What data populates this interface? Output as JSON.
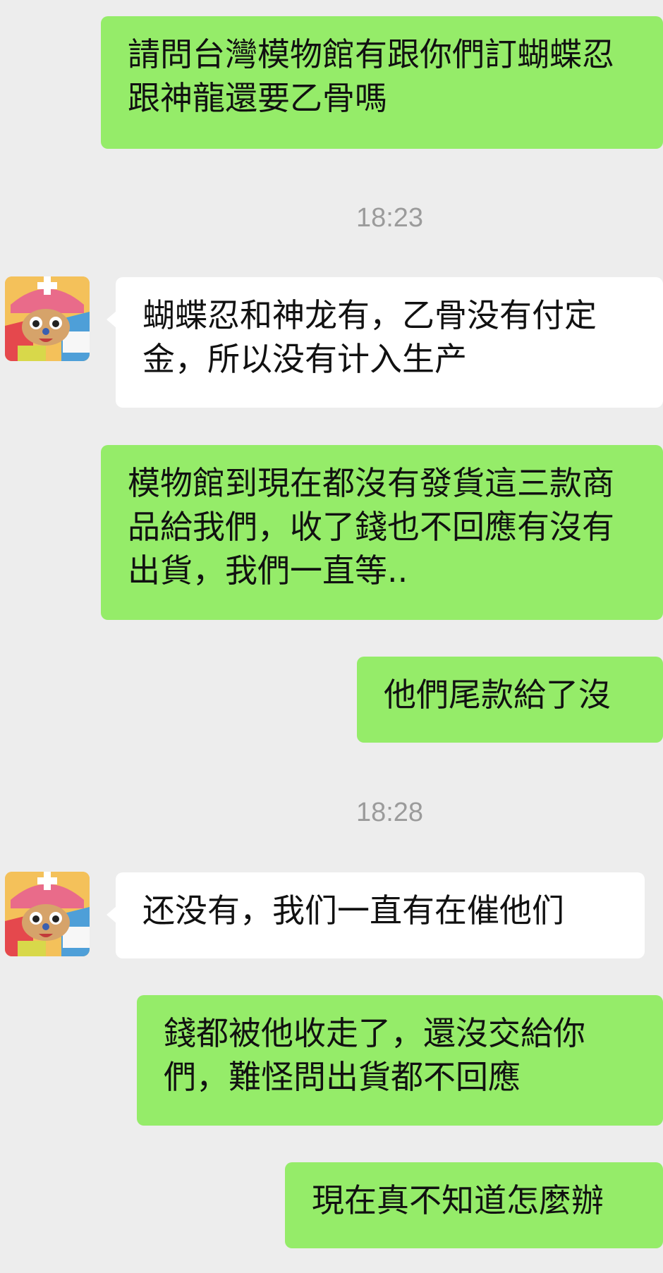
{
  "colors": {
    "background": "#ededed",
    "outgoing_bubble": "#95ec69",
    "incoming_bubble": "#ffffff",
    "timestamp_text": "#9b9b9b"
  },
  "messages": [
    {
      "direction": "outgoing",
      "text": "請問台灣模物館有跟你們訂蝴蝶忍跟神龍還要乙骨嗎"
    },
    {
      "direction": "timestamp",
      "text": "18:23"
    },
    {
      "direction": "incoming",
      "avatar_icon": "cartoon-character-avatar",
      "text": "蝴蝶忍和神龙有，乙骨没有付定金，所以没有计入生产"
    },
    {
      "direction": "outgoing",
      "text": "模物館到現在都沒有發貨這三款商品給我們，收了錢也不回應有沒有出貨，我們一直等.."
    },
    {
      "direction": "outgoing",
      "text": "他們尾款給了沒"
    },
    {
      "direction": "timestamp",
      "text": "18:28"
    },
    {
      "direction": "incoming",
      "avatar_icon": "cartoon-character-avatar",
      "text": "还没有，我们一直有在催他们"
    },
    {
      "direction": "outgoing",
      "text": "錢都被他收走了，還沒交給你們，難怪問出貨都不回應"
    },
    {
      "direction": "outgoing",
      "text": "現在真不知道怎麼辦"
    }
  ]
}
